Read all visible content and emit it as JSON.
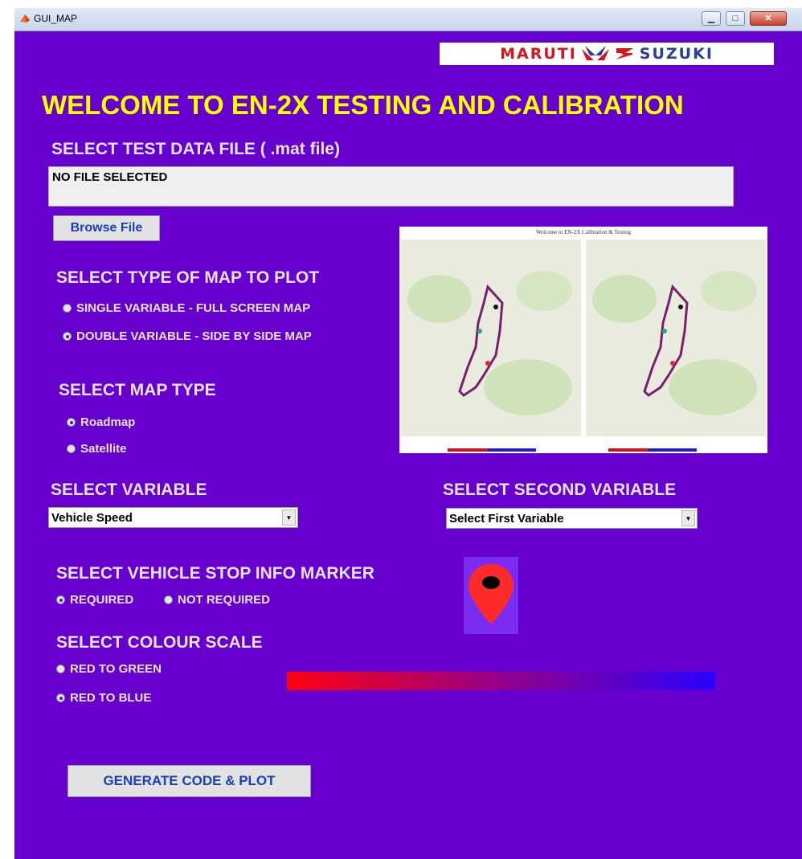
{
  "window": {
    "title": "GUI_MAP"
  },
  "brand": {
    "left_word": "MARUTI",
    "right_word": "SUZUKI",
    "red": "#d8141e",
    "blue": "#2a3c9e"
  },
  "heading": "WELCOME TO EN-2X TESTING AND CALIBRATION",
  "file_section": {
    "label": "SELECT TEST DATA FILE ( .mat file)",
    "status": "NO FILE SELECTED",
    "browse_label": "Browse File"
  },
  "map_plot_section": {
    "label": "SELECT TYPE OF MAP TO PLOT",
    "options": [
      {
        "label": "SINGLE VARIABLE - FULL SCREEN MAP",
        "selected": false
      },
      {
        "label": "DOUBLE VARIABLE - SIDE BY SIDE MAP",
        "selected": true
      }
    ]
  },
  "map_type_section": {
    "label": "SELECT MAP TYPE",
    "options": [
      {
        "label": "Roadmap",
        "selected": true
      },
      {
        "label": "Satellite",
        "selected": false
      }
    ]
  },
  "preview": {
    "caption": "Welcome to EN-2X Calibration & Testing"
  },
  "variable_section": {
    "label": "SELECT VARIABLE",
    "selected": "Vehicle Speed"
  },
  "second_variable_section": {
    "label": "SELECT SECOND VARIABLE",
    "selected": "Select First Variable"
  },
  "stop_marker_section": {
    "label": "SELECT VEHICLE STOP INFO MARKER",
    "options": [
      {
        "label": "REQUIRED",
        "selected": true
      },
      {
        "label": "NOT REQUIRED",
        "selected": false
      }
    ]
  },
  "colour_scale_section": {
    "label": "SELECT COLOUR SCALE",
    "options": [
      {
        "label": "RED TO GREEN",
        "selected": false
      },
      {
        "label": "RED TO BLUE",
        "selected": true
      }
    ],
    "gradient_from": "#ff0010",
    "gradient_to": "#2a00ff"
  },
  "generate_label": "GENERATE CODE & PLOT",
  "colors": {
    "background": "#6700cf",
    "heading": "#ffff00",
    "section_text": "#e4e4ef",
    "button_text": "#1a3fb3"
  }
}
